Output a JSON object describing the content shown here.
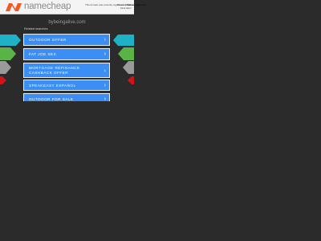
{
  "header": {
    "brand": "namecheap",
    "note_line1": "This domain was recently registered at",
    "note_link": "Namecheap.com",
    "note_right_line1": "Please check",
    "note_right_line2": "back later!"
  },
  "domain": "bybeingalive.com",
  "related_title": "Related searches",
  "links": [
    {
      "label": "Outdoor Offer"
    },
    {
      "label": "Fat Joe Sex"
    },
    {
      "label": "Mortgage Refinance Cashback Offer"
    },
    {
      "label": "Speakeasy Español"
    },
    {
      "label": "Outdoor for Sale"
    }
  ],
  "colors": {
    "background": "#2b2b2b",
    "button": "#3a8ef4",
    "logo_orange": "#f15a22",
    "wing_teal": "#1fb2c6",
    "wing_green": "#5ab347",
    "wing_gray": "#9a9a9a",
    "wing_red": "#d0141c"
  },
  "icons": {
    "chevron": "›"
  }
}
